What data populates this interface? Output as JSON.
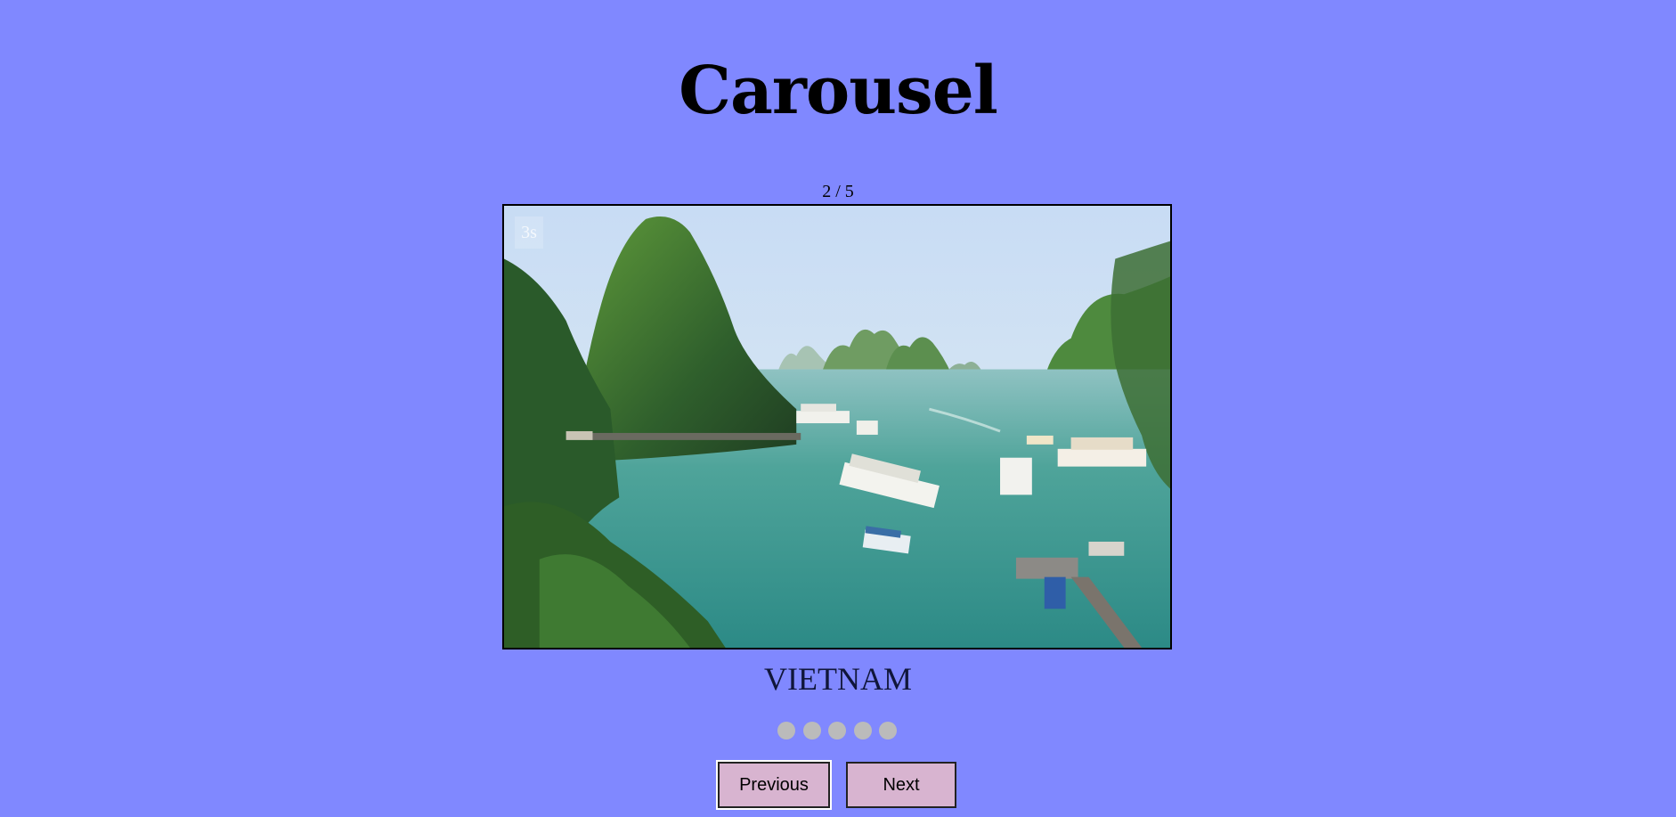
{
  "page": {
    "title": "Carousel"
  },
  "carousel": {
    "counter": "2 / 5",
    "timer": "3s",
    "caption": "VIETNAM",
    "image": {
      "subject": "Ha Long Bay with limestone karsts and tour boats"
    },
    "total_slides": 5,
    "current_slide": 2,
    "indicator_color": "#bbbbbb"
  },
  "controls": {
    "previous_label": "Previous",
    "next_label": "Next"
  },
  "colors": {
    "background": "#8088ff",
    "button": "#d8b4d0"
  }
}
